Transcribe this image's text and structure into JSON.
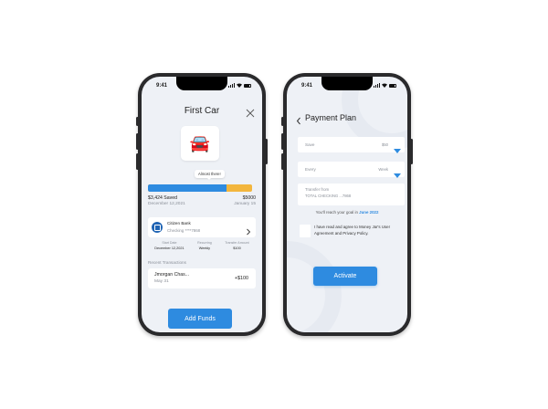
{
  "status": {
    "time": "9:41"
  },
  "screen1": {
    "title": "First Car",
    "car_emoji": "🚘",
    "tooltip": "Almost there!",
    "progress_fraction": 0.75,
    "saved": "$3,424 Saved",
    "goal": "$5000",
    "start_date": "December 12,2021",
    "end_date": "January 15",
    "bank": {
      "name": "Citizen Bank",
      "account": "Checking ****7868"
    },
    "details": [
      {
        "label": "Start Date",
        "value": "December 12,2021"
      },
      {
        "label": "Recurring",
        "value": "Weekly"
      },
      {
        "label": "Transfer Amount",
        "value": "$100"
      }
    ],
    "recent_label": "Recent Transactions",
    "transaction": {
      "name": "Jmorgan Chas...",
      "date": "May 31",
      "amount": "+$100"
    },
    "add_funds": "Add Funds"
  },
  "screen2": {
    "title": "Payment Plan",
    "save_field": {
      "label": "Save",
      "value": "$50"
    },
    "every_field": {
      "label": "Every",
      "value": "Week"
    },
    "transfer_from": {
      "label": "Transfer from",
      "value": "TOTAL CHECKING ...7868"
    },
    "goal_text": "You'll reach your goal in",
    "goal_date": "June 2022",
    "agreement": "I have read and agree to Money Jar's User Agreement and Privacy Policy.",
    "activate": "Activate"
  },
  "colors": {
    "accent": "#2e8be0",
    "progress_remaining": "#f3b63d",
    "screen_bg": "#eef1f6"
  }
}
